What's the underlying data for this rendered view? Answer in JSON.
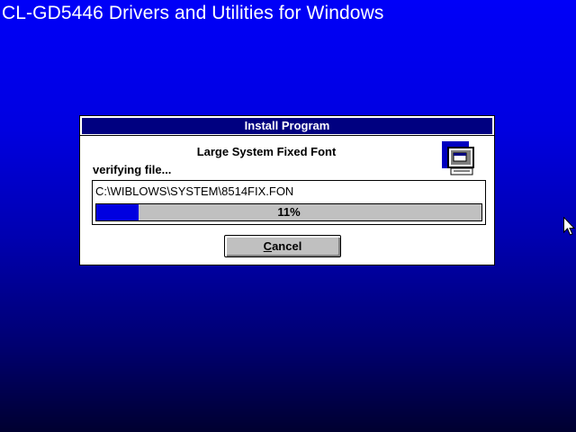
{
  "screen": {
    "title": "CL-GD5446 Drivers and Utilities for Windows",
    "background_color_top": "#0000f8",
    "background_color_bottom": "#000030"
  },
  "dialog": {
    "title": "Install Program",
    "item_name": "Large System Fixed Font",
    "status": "verifying file...",
    "icon": "setup-computer-icon",
    "file_path": "C:\\WIBLOWS\\SYSTEM\\8514FIX.FON",
    "progress": {
      "value": 0.11,
      "label": "11%",
      "fill_color": "#0000e0"
    },
    "cancel_button": {
      "mnemonic": "C",
      "rest": "ancel"
    }
  },
  "cursor": {
    "icon": "mouse-pointer-icon"
  }
}
